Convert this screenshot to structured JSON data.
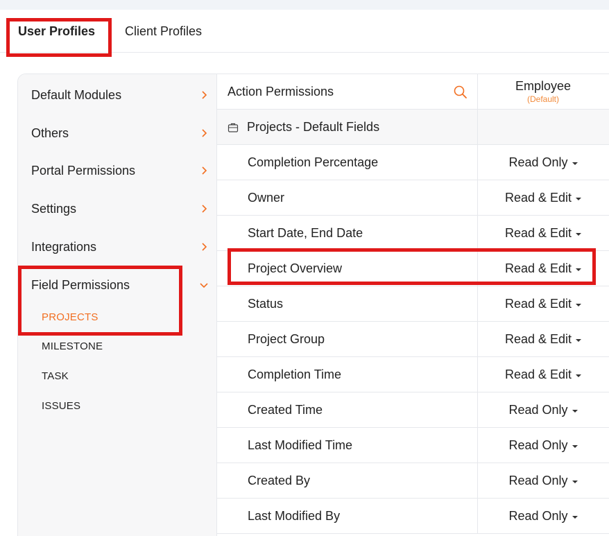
{
  "tabs": [
    {
      "label": "User Profiles"
    },
    {
      "label": "Client Profiles"
    }
  ],
  "sidebar": {
    "items": [
      {
        "label": "Default Modules"
      },
      {
        "label": "Others"
      },
      {
        "label": "Portal Permissions"
      },
      {
        "label": "Settings"
      },
      {
        "label": "Integrations"
      },
      {
        "label": "Field Permissions"
      }
    ],
    "sub_items": [
      {
        "label": "PROJECTS"
      },
      {
        "label": "MILESTONE"
      },
      {
        "label": "TASK"
      },
      {
        "label": "ISSUES"
      }
    ]
  },
  "table": {
    "header": {
      "title": "Action Permissions",
      "column": "Employee",
      "column_sub": "(Default)"
    },
    "group": {
      "title": "Projects - Default Fields"
    },
    "rows": [
      {
        "name": "Completion Percentage",
        "permission": "Read Only"
      },
      {
        "name": "Owner",
        "permission": "Read & Edit"
      },
      {
        "name": "Start Date, End Date",
        "permission": "Read & Edit"
      },
      {
        "name": "Project Overview",
        "permission": "Read & Edit"
      },
      {
        "name": "Status",
        "permission": "Read & Edit"
      },
      {
        "name": "Project Group",
        "permission": "Read & Edit"
      },
      {
        "name": "Completion Time",
        "permission": "Read & Edit"
      },
      {
        "name": "Created Time",
        "permission": "Read Only"
      },
      {
        "name": "Last Modified Time",
        "permission": "Read Only"
      },
      {
        "name": "Created By",
        "permission": "Read Only"
      },
      {
        "name": "Last Modified By",
        "permission": "Read Only"
      }
    ]
  },
  "colors": {
    "accent": "#f26f21",
    "highlight": "#e01919"
  }
}
